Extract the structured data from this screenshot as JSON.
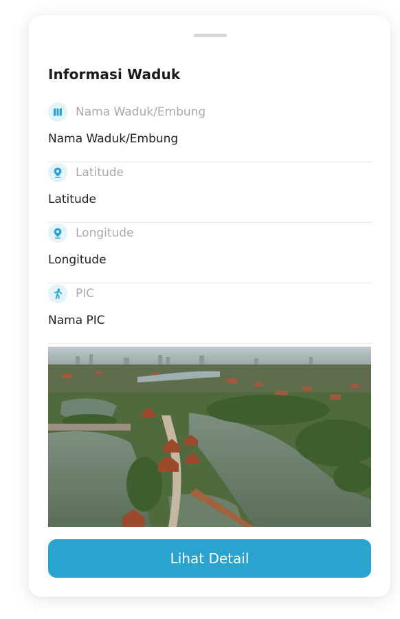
{
  "colors": {
    "accent": "#2aa3ce",
    "icon_background": "#e3f3fa",
    "label_text": "#a9a9a9",
    "value_text": "#1f1f1f",
    "divider": "#e7e7e7"
  },
  "sheet": {
    "title": "Informasi Waduk",
    "fields": [
      {
        "icon": "map-icon",
        "label": "Nama Waduk/Embung",
        "value": "Nama Waduk/Embung"
      },
      {
        "icon": "location-pin-icon",
        "label": "Latitude",
        "value": "Latitude"
      },
      {
        "icon": "location-pin-icon",
        "label": "Longitude",
        "value": "Longitude"
      },
      {
        "icon": "person-icon",
        "label": "PIC",
        "value": "Nama PIC"
      }
    ],
    "photo": {
      "subject": "aerial view of reservoir with walkways and red-roofed pavilions"
    },
    "detail_button_label": "Lihat Detail"
  }
}
